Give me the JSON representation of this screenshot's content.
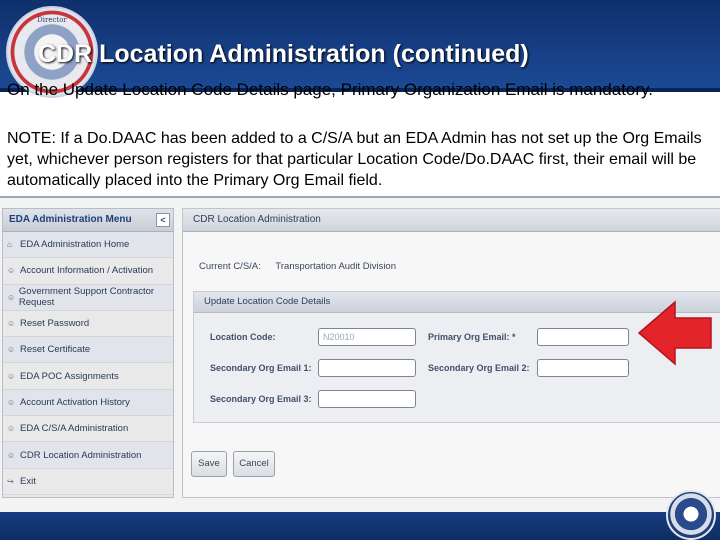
{
  "slide": {
    "title": "CDR Location Administration (continued)",
    "lead": "On the Update Location Code Details page, Primary Organization Email is mandatory.",
    "note": "NOTE: If a Do.DAAC has been added to a C/S/A but an EDA Admin has not set up the Org Emails yet, whichever person registers for that particular Location Code/Do.DAAC first, their email will be automatically placed into the Primary Org Email field."
  },
  "sidebar": {
    "header": "EDA Administration Menu",
    "collapse_glyph": "<",
    "items": [
      {
        "label": "EDA Administration Home",
        "icon": "home-icon",
        "glyph": "⌂"
      },
      {
        "label": "Account Information / Activation",
        "icon": "user-icon",
        "glyph": "☺"
      },
      {
        "label": "Government Support Contractor Request",
        "icon": "user-icon",
        "glyph": "☺"
      },
      {
        "label": "Reset Password",
        "icon": "user-icon",
        "glyph": "☺"
      },
      {
        "label": "Reset Certificate",
        "icon": "user-icon",
        "glyph": "☺"
      },
      {
        "label": "EDA POC Assignments",
        "icon": "user-icon",
        "glyph": "☺"
      },
      {
        "label": "Account Activation History",
        "icon": "user-icon",
        "glyph": "☺"
      },
      {
        "label": "EDA C/S/A Administration",
        "icon": "user-icon",
        "glyph": "☺"
      },
      {
        "label": "CDR Location Administration",
        "icon": "user-icon",
        "glyph": "☺"
      },
      {
        "label": "Exit",
        "icon": "exit-icon",
        "glyph": "↪"
      }
    ]
  },
  "main": {
    "header": "CDR Location Administration",
    "current_label": "Current C/S/A:",
    "current_value": "Transportation Audit Division",
    "section_header": "Update Location Code Details",
    "fields": {
      "location_code_label": "Location Code:",
      "location_code_value": "N20010",
      "primary_email_label": "Primary Org Email: *",
      "primary_email_value": "",
      "secondary_email_1_label": "Secondary Org Email 1:",
      "secondary_email_1_value": "",
      "secondary_email_2_label": "Secondary Org Email 2:",
      "secondary_email_2_value": "",
      "secondary_email_3_label": "Secondary Org Email 3:",
      "secondary_email_3_value": ""
    },
    "save_label": "Save",
    "cancel_label": "Cancel"
  },
  "colors": {
    "banner": "#173f86",
    "arrow": "#e3242b"
  }
}
